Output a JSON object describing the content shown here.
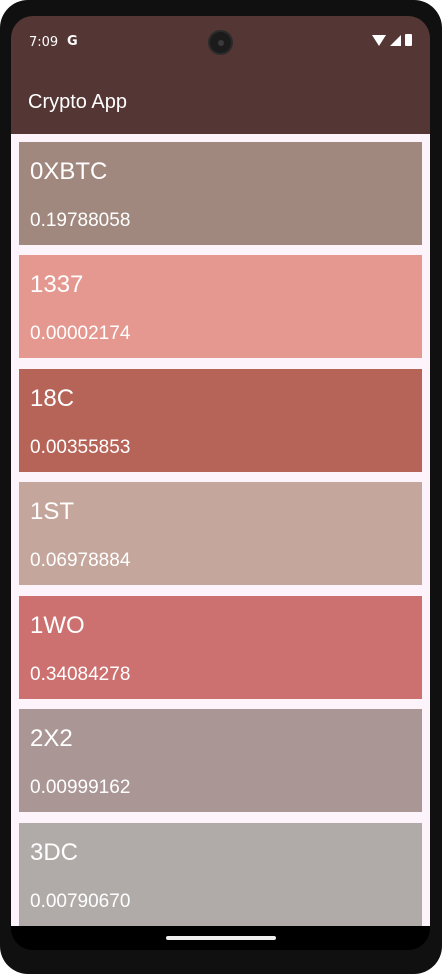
{
  "status": {
    "time": "7:09",
    "g_icon": "G"
  },
  "appbar": {
    "title": "Crypto App"
  },
  "coins": [
    {
      "name": "0XBTC",
      "price": "0.19788058",
      "color": "#a1887f"
    },
    {
      "name": "1337",
      "price": "0.00002174",
      "color": "#e5988f"
    },
    {
      "name": "18C",
      "price": "0.00355853",
      "color": "#b66358"
    },
    {
      "name": "1ST",
      "price": "0.06978884",
      "color": "#c4a69c"
    },
    {
      "name": "1WO",
      "price": "0.34084278",
      "color": "#cc7070"
    },
    {
      "name": "2X2",
      "price": "0.00999162",
      "color": "#aa9694"
    },
    {
      "name": "3DC",
      "price": "0.00790670",
      "color": "#b0aba8"
    }
  ]
}
